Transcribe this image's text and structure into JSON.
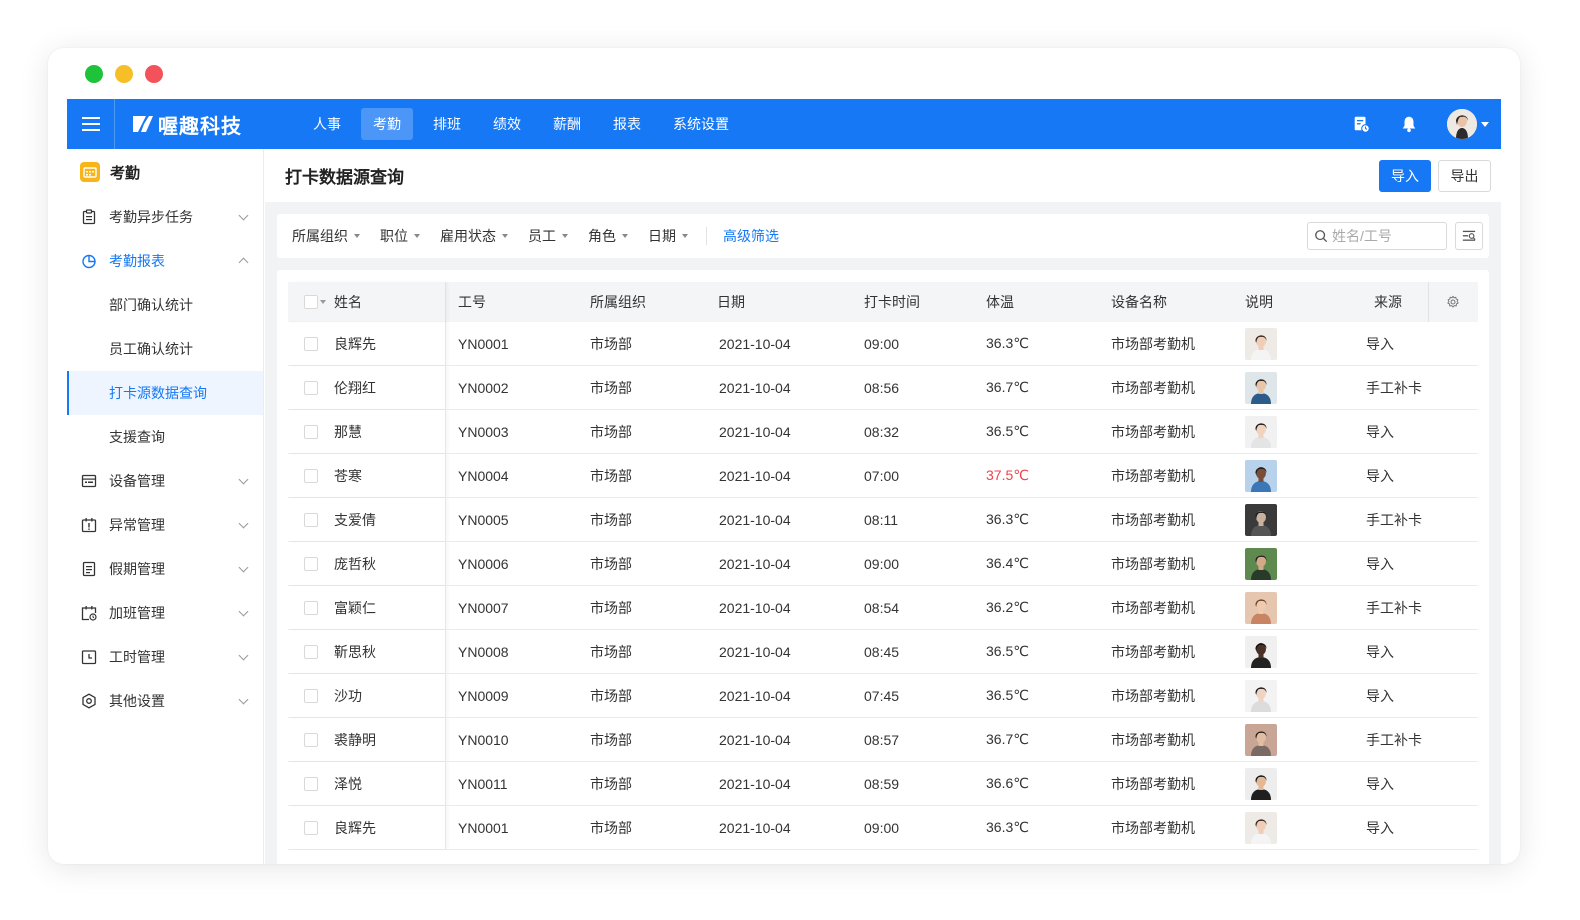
{
  "app": {
    "brand": "喔趣科技",
    "nav": [
      "人事",
      "考勤",
      "排班",
      "绩效",
      "薪酬",
      "报表",
      "系统设置"
    ],
    "active_nav": "考勤"
  },
  "sidebar": {
    "title": "考勤",
    "items": [
      {
        "label": "考勤异步任务",
        "icon": "clipboard-icon"
      },
      {
        "label": "考勤报表",
        "icon": "pie-chart-icon",
        "open": true,
        "children": [
          "部门确认统计",
          "员工确认统计",
          "打卡源数据查询",
          "支援查询"
        ],
        "active_child": "打卡源数据查询"
      },
      {
        "label": "设备管理",
        "icon": "device-icon"
      },
      {
        "label": "异常管理",
        "icon": "calendar-alert-icon"
      },
      {
        "label": "假期管理",
        "icon": "document-icon"
      },
      {
        "label": "加班管理",
        "icon": "calendar-clock-icon"
      },
      {
        "label": "工时管理",
        "icon": "clock-icon"
      },
      {
        "label": "其他设置",
        "icon": "settings-icon"
      }
    ]
  },
  "page": {
    "title": "打卡数据源查询",
    "import_label": "导入",
    "export_label": "导出"
  },
  "filters": {
    "items": [
      "所属组织",
      "职位",
      "雇用状态",
      "员工",
      "角色",
      "日期"
    ],
    "advanced": "高级筛选",
    "search_placeholder": "姓名/工号"
  },
  "table": {
    "columns": [
      "姓名",
      "工号",
      "所属组织",
      "日期",
      "打卡时间",
      "体温",
      "设备名称",
      "说明",
      "来源"
    ],
    "rows": [
      {
        "name": "良辉先",
        "id": "YN0001",
        "org": "市场部",
        "date": "2021-10-04",
        "time": "09:00",
        "temp": "36.3℃",
        "high": false,
        "device": "市场部考勤机",
        "source": "导入",
        "photo": "woman-1"
      },
      {
        "name": "伦翔红",
        "id": "YN0002",
        "org": "市场部",
        "date": "2021-10-04",
        "time": "08:56",
        "temp": "36.7℃",
        "high": false,
        "device": "市场部考勤机",
        "source": "手工补卡",
        "photo": "man-1"
      },
      {
        "name": "那慧",
        "id": "YN0003",
        "org": "市场部",
        "date": "2021-10-04",
        "time": "08:32",
        "temp": "36.5℃",
        "high": false,
        "device": "市场部考勤机",
        "source": "导入",
        "photo": "woman-2"
      },
      {
        "name": "苍寒",
        "id": "YN0004",
        "org": "市场部",
        "date": "2021-10-04",
        "time": "07:00",
        "temp": "37.5℃",
        "high": true,
        "device": "市场部考勤机",
        "source": "导入",
        "photo": "man-2"
      },
      {
        "name": "支爱倩",
        "id": "YN0005",
        "org": "市场部",
        "date": "2021-10-04",
        "time": "08:11",
        "temp": "36.3℃",
        "high": false,
        "device": "市场部考勤机",
        "source": "手工补卡",
        "photo": "woman-3"
      },
      {
        "name": "庞哲秋",
        "id": "YN0006",
        "org": "市场部",
        "date": "2021-10-04",
        "time": "09:00",
        "temp": "36.4℃",
        "high": false,
        "device": "市场部考勤机",
        "source": "导入",
        "photo": "man-3"
      },
      {
        "name": "富颖仁",
        "id": "YN0007",
        "org": "市场部",
        "date": "2021-10-04",
        "time": "08:54",
        "temp": "36.2℃",
        "high": false,
        "device": "市场部考勤机",
        "source": "手工补卡",
        "photo": "woman-4"
      },
      {
        "name": "靳思秋",
        "id": "YN0008",
        "org": "市场部",
        "date": "2021-10-04",
        "time": "08:45",
        "temp": "36.5℃",
        "high": false,
        "device": "市场部考勤机",
        "source": "导入",
        "photo": "man-4"
      },
      {
        "name": "沙功",
        "id": "YN0009",
        "org": "市场部",
        "date": "2021-10-04",
        "time": "07:45",
        "temp": "36.5℃",
        "high": false,
        "device": "市场部考勤机",
        "source": "导入",
        "photo": "woman-5"
      },
      {
        "name": "裘静明",
        "id": "YN0010",
        "org": "市场部",
        "date": "2021-10-04",
        "time": "08:57",
        "temp": "36.7℃",
        "high": false,
        "device": "市场部考勤机",
        "source": "手工补卡",
        "photo": "man-5"
      },
      {
        "name": "泽悦",
        "id": "YN0011",
        "org": "市场部",
        "date": "2021-10-04",
        "time": "08:59",
        "temp": "36.6℃",
        "high": false,
        "device": "市场部考勤机",
        "source": "导入",
        "photo": "man-6"
      },
      {
        "name": "良辉先",
        "id": "YN0001",
        "org": "市场部",
        "date": "2021-10-04",
        "time": "09:00",
        "temp": "36.3℃",
        "high": false,
        "device": "市场部考勤机",
        "source": "导入",
        "photo": "woman-1"
      }
    ]
  },
  "colors": {
    "primary": "#1678f5",
    "warning": "#f0424b",
    "calendar_icon": "#f7b51a"
  }
}
